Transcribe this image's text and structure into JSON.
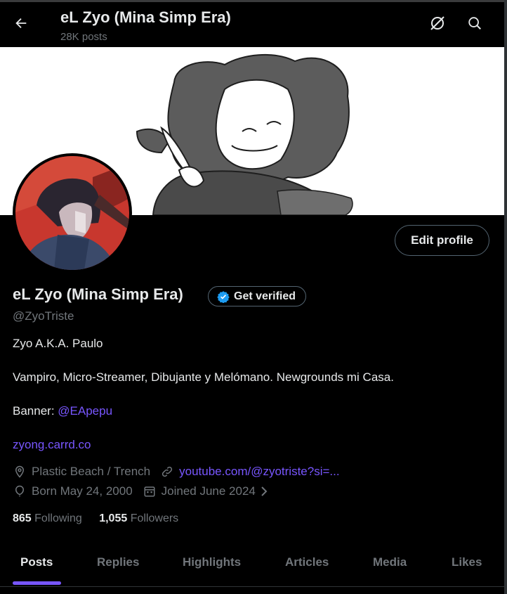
{
  "header": {
    "title": "eL Zyo (Mina Simp Era)",
    "post_count": "28K posts"
  },
  "profile": {
    "name": "eL Zyo (Mina Simp Era)",
    "get_verified": "Get verified",
    "handle": "@ZyoTriste",
    "edit_profile": "Edit profile",
    "bio_line1": "Zyo A.K.A. Paulo",
    "bio_line2": "Vampiro, Micro-Streamer, Dibujante y Melómano. Newgrounds mi Casa.",
    "bio_banner_prefix": "Banner: ",
    "bio_banner_mention": "@EApepu",
    "bio_site": "zyong.carrd.co",
    "location": "Plastic Beach / Trench",
    "website": "youtube.com/@zyotriste?si=...",
    "born": "Born May 24, 2000",
    "joined": "Joined June 2024",
    "following_count": "865",
    "following_label": "Following",
    "followers_count": "1,055",
    "followers_label": "Followers"
  },
  "tabs": [
    {
      "label": "Posts",
      "active": true
    },
    {
      "label": "Replies"
    },
    {
      "label": "Highlights"
    },
    {
      "label": "Articles"
    },
    {
      "label": "Media"
    },
    {
      "label": "Likes"
    }
  ],
  "colors": {
    "accent": "#7856ff",
    "verified": "#1d9bf0",
    "muted": "#71767b",
    "text": "#e7e9ea"
  },
  "icons": [
    "back-arrow-icon",
    "grok-icon",
    "search-icon",
    "verified-badge-icon",
    "location-icon",
    "link-icon",
    "balloon-icon",
    "calendar-icon",
    "chevron-right-icon"
  ]
}
